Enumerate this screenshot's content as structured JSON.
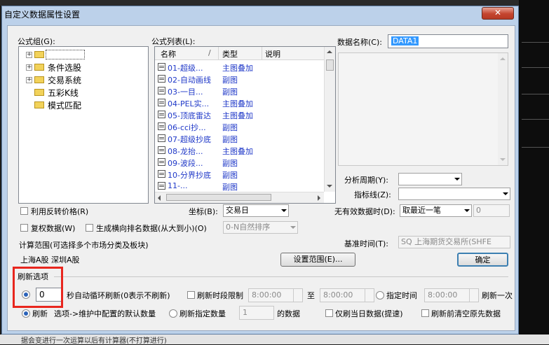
{
  "window": {
    "title": "自定义数据属性设置",
    "close_icon": "close-icon"
  },
  "formula_group": {
    "label": "公式组(G):",
    "items": [
      "",
      "条件选股",
      "交易系统",
      "五彩K线",
      "模式匹配"
    ]
  },
  "formula_list": {
    "label": "公式列表(L):",
    "columns": [
      "名称",
      "类型",
      "说明"
    ],
    "rows": [
      {
        "name": "01-超级...",
        "type": "主图叠加"
      },
      {
        "name": "02-自动画线",
        "type": "副图"
      },
      {
        "name": "03-一目...",
        "type": "副图"
      },
      {
        "name": "04-PEL实...",
        "type": "主图叠加"
      },
      {
        "name": "05-顶底雷达",
        "type": "主图叠加"
      },
      {
        "name": "06-cci抄...",
        "type": "副图"
      },
      {
        "name": "07-超级抄底",
        "type": "副图"
      },
      {
        "name": "08-龙抬...",
        "type": "主图叠加"
      },
      {
        "name": "09-波段...",
        "type": "副图"
      },
      {
        "name": "10-分界抄底",
        "type": "副图"
      },
      {
        "name": "11-...",
        "type": "副图"
      }
    ]
  },
  "data_name": {
    "label": "数据名称(C):",
    "value": "DATA1"
  },
  "period": {
    "label": "分析周期(Y):",
    "value": ""
  },
  "indicator": {
    "label": "指标线(Z):",
    "value": ""
  },
  "coord": {
    "label": "坐标(B):",
    "value": "交易日"
  },
  "nodata": {
    "label": "无有效数据时(D):",
    "value": "取最近一笔",
    "number": "0"
  },
  "options": {
    "turnover_price": "利用反转价格(R)",
    "adjusted": "复权数据(W)",
    "rank": "生成横向排名数据(从大到小)(O)",
    "rank_mode": "0-N自然排序"
  },
  "calc_range": {
    "label": "计算范围(可选择多个市场分类及板块)",
    "value": "上海A股  深圳A股",
    "button": "设置范围(E)..."
  },
  "base_time": {
    "label": "基准时间(T):",
    "value": "SQ 上海期货交易所(SHFE"
  },
  "ok_button": "确定",
  "refresh": {
    "section_label": "刷新选项",
    "interval_value": "0",
    "interval_text": "秒自动循环刷新(0表示不刷新)",
    "time_limit_label": "刷新时段限制",
    "time_from": "8:00:00",
    "to_label": "至",
    "time_to": "8:00:00",
    "specified_label": "指定时间",
    "specified_time": "8:00:00",
    "once_label": "刷新一次",
    "refresh_radio": "刷新",
    "config_text": "选项->维护中配置的默认数量",
    "count_label": "刷新指定数量",
    "count_value": "1",
    "count_unit": "的数据",
    "today_only": "仅刷当日数据(提速)",
    "clear_first": "刷新前清空原先数据"
  },
  "bottom_text": "据会变进行一次运算以后有计算器(不打算进行)"
}
